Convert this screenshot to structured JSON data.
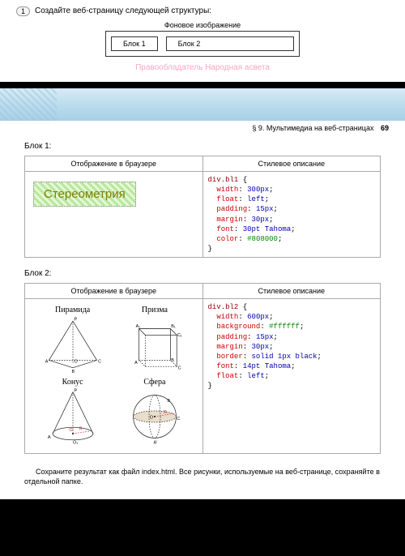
{
  "page1": {
    "task_number": "1",
    "task_text": "Создайте веб-страницу следующей структуры:",
    "bg_label": "Фоновое изображение",
    "block1": "Блок 1",
    "block2": "Блок 2",
    "watermark": "Правообладатель Народная асвета"
  },
  "page2": {
    "section": "§ 9. Мультимедиа на веб-страницах",
    "page_num": "69",
    "block1_label": "Блок 1:",
    "block2_label": "Блок 2:",
    "th_browser": "Отображение в браузере",
    "th_style": "Стилевое описание",
    "stereo": "Стереометрия",
    "css1": {
      "sel": "div.bl1",
      "p1": "width",
      "v1": "300px",
      "p2": "float",
      "v2": "left",
      "p3": "padding",
      "v3": "15px",
      "p4": "margin",
      "v4": "30px",
      "p5": "font",
      "v5": "30pt Tahoma",
      "p6": "color",
      "v6": "#808000"
    },
    "css2": {
      "sel": "div.bl2",
      "p1": "width",
      "v1": "600px",
      "p2": "background",
      "v2": "#ffffff",
      "p3": "padding",
      "v3": "15px",
      "p4": "margin",
      "v4": "30px",
      "p5": "border",
      "v5": "solid 1px black",
      "p6": "font",
      "v6": "14pt Tahoma",
      "p7": "float",
      "v7": "left"
    },
    "shapes": {
      "pyramid": "Пирамида",
      "prism": "Призма",
      "cone": "Конус",
      "sphere": "Сфера"
    },
    "footnote": "Сохраните результат как файл index.html. Все рисунки, используемые на веб-странице, сохраняйте в отдельной папке."
  }
}
